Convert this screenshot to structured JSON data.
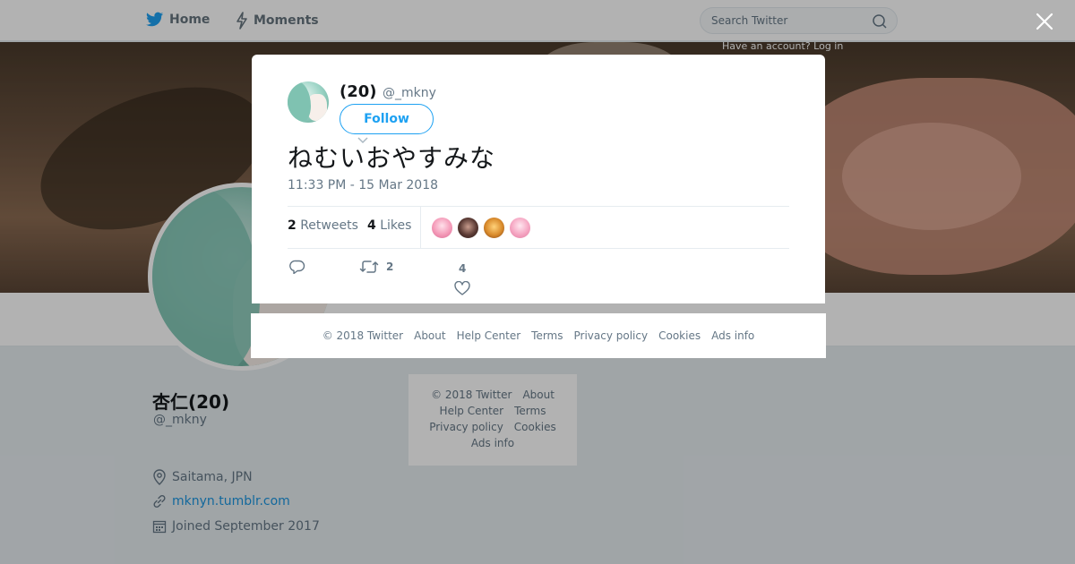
{
  "topbar": {
    "home_label": "Home",
    "moments_label": "Moments",
    "search_placeholder": "Search Twitter",
    "login_hint": "Have an account? Log in"
  },
  "profile": {
    "name": "杏仁(20)",
    "handle": "@_mkny",
    "location": "Saitama, JPN",
    "url": "mknyn.tumblr.com",
    "joined": "Joined September 2017"
  },
  "side_footer": {
    "links": [
      "© 2018 Twitter",
      "About",
      "Help Center",
      "Terms",
      "Privacy policy",
      "Cookies",
      "Ads info"
    ]
  },
  "modal": {
    "name": "(20)",
    "handle": "@_mkny",
    "follow_label": "Follow",
    "tweet_text": "ねむいおやすみな",
    "time": "11:33 PM - 15 Mar 2018",
    "retweets_count": "2",
    "retweets_label": "Retweets",
    "likes_count": "4",
    "likes_label": "Likes",
    "action_retweet_count": "2",
    "action_like_count": "4"
  },
  "modal_footer": {
    "links": [
      "© 2018 Twitter",
      "About",
      "Help Center",
      "Terms",
      "Privacy policy",
      "Cookies",
      "Ads info"
    ]
  },
  "colors": {
    "accent": "#1da1f2",
    "overlay": "rgba(0,0,0,0.30)",
    "text_secondary": "#657786"
  }
}
